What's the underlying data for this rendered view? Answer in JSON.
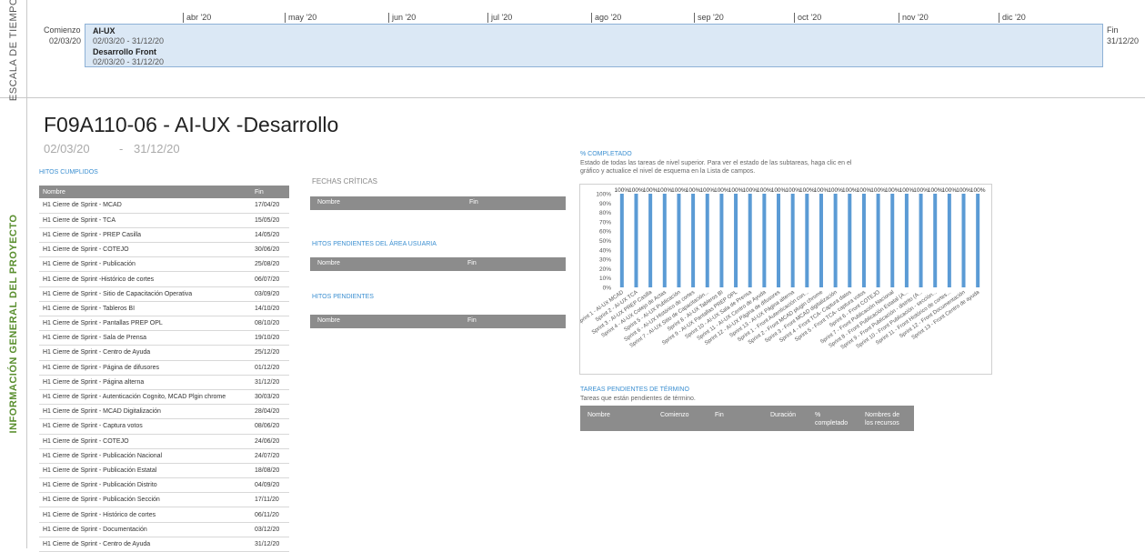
{
  "timeline": {
    "side_label": "ESCALA DE TIEMPO",
    "start_label": "Comienzo",
    "start_date": "02/03/20",
    "end_label": "Fin",
    "end_date": "31/12/20",
    "months": [
      "abr '20",
      "may '20",
      "jun '20",
      "jul '20",
      "ago '20",
      "sep '20",
      "oct '20",
      "nov '20",
      "dic '20"
    ],
    "tasks": [
      {
        "name": "AI-UX",
        "dates": "02/03/20 - 31/12/20"
      },
      {
        "name": "Desarrollo Front",
        "dates": "02/03/20 - 31/12/20"
      }
    ]
  },
  "info": {
    "side_label": "INFORMACIÓN GENERAL DEL PROYECTO",
    "title": "F09A110-06 - AI-UX -Desarrollo",
    "start": "02/03/20",
    "separator": "-",
    "end": "31/12/20"
  },
  "hitos": {
    "title": "HITOS CUMPLIDOS",
    "col_name": "Nombre",
    "col_fin": "Fin",
    "rows": [
      {
        "name": "H1 Cierre de Sprint - MCAD",
        "fin": "17/04/20"
      },
      {
        "name": "H1 Cierre de Sprint - TCA",
        "fin": "15/05/20"
      },
      {
        "name": "H1 Cierre de Sprint - PREP Casilla",
        "fin": "14/05/20"
      },
      {
        "name": "H1 Cierre de Sprint - COTEJO",
        "fin": "30/06/20"
      },
      {
        "name": "H1 Cierre de Sprint - Publicación",
        "fin": "25/08/20"
      },
      {
        "name": "H1 Cierre de Sprint -Histórico de cortes",
        "fin": "06/07/20"
      },
      {
        "name": "H1 Cierre de Sprint - Sitio de Capacitación Operativa",
        "fin": "03/09/20"
      },
      {
        "name": "H1 Cierre de Sprint - Tableros BI",
        "fin": "14/10/20"
      },
      {
        "name": "H1 Cierre de Sprint - Pantallas PREP OPL",
        "fin": "08/10/20"
      },
      {
        "name": "H1 Cierre de Sprint - Sala de Prensa",
        "fin": "19/10/20"
      },
      {
        "name": "H1 Cierre de Sprint - Centro de Ayuda",
        "fin": "25/12/20"
      },
      {
        "name": "H1 Cierre de Sprint - Página de difusores",
        "fin": "01/12/20"
      },
      {
        "name": "H1 Cierre de Sprint - Página alterna",
        "fin": "31/12/20"
      },
      {
        "name": "H1 Cierre de Sprint - Autenticación Cognito, MCAD Plgin chrome",
        "fin": "30/03/20"
      },
      {
        "name": "H1 Cierre de Sprint - MCAD Digitalización",
        "fin": "28/04/20"
      },
      {
        "name": "H1 Cierre de Sprint - Captura votos",
        "fin": "08/06/20"
      },
      {
        "name": "H1 Cierre de Sprint - COTEJO",
        "fin": "24/06/20"
      },
      {
        "name": "H1 Cierre de Sprint - Publicación Nacional",
        "fin": "24/07/20"
      },
      {
        "name": "H1 Cierre de Sprint - Publicación Estatal",
        "fin": "18/08/20"
      },
      {
        "name": "H1 Cierre de Sprint - Publicación Distrito",
        "fin": "04/09/20"
      },
      {
        "name": "H1 Cierre de Sprint - Publicación Sección",
        "fin": "17/11/20"
      },
      {
        "name": "H1 Cierre de Sprint - Histórico de cortes",
        "fin": "06/11/20"
      },
      {
        "name": "H1 Cierre de Sprint - Documentación",
        "fin": "03/12/20"
      },
      {
        "name": "H1 Cierre de Sprint - Centro de Ayuda",
        "fin": "31/12/20"
      }
    ]
  },
  "fechas_criticas": {
    "title": "FECHAS CRÍTICAS",
    "col_name": "Nombre",
    "col_fin": "Fin"
  },
  "hitos_usuaria": {
    "title": "HITOS PENDIENTES DEL ÁREA USUARIA",
    "col_name": "Nombre",
    "col_fin": "Fin"
  },
  "hitos_pendientes": {
    "title": "HITOS PENDIENTES",
    "col_name": "Nombre",
    "col_fin": "Fin"
  },
  "completado": {
    "title": "% COMPLETADO",
    "subtitle_line1": "Estado de todas las tareas de nivel superior. Para ver el estado de las subtareas, haga clic en el",
    "subtitle_line2": "gráfico y actualice el nivel de esquema en la Lista de campos."
  },
  "chart_data": {
    "type": "bar",
    "categories": [
      "Sprint 1 - AI-UX MCAD",
      "Sprint 2 - AI-UX TCA",
      "Sprint 3 - AI-UX PREP Casilla",
      "Sprint 4 - AI-UX Cotejo de Actas",
      "Sprint 5 - AI-UX Publicación",
      "Sprint 6 - AI-UX Histórico de cortes",
      "Sprint 7 - AI-UX Sitio de Capacitación...",
      "Sprint 8 - AI-UX Tableros BI",
      "Sprint 9 - AI-UX Pantallas PREP OPL",
      "Sprint 10 - AI-UX Sala de Prensa",
      "Sprint 11 - AI-UX Centro de Ayuda",
      "Sprint 12 - AI-UX Página de difusores",
      "Sprint 13 - AI-UX Página alterna",
      "Sprint 1 - Front Autenticación con...",
      "Sprint 2 - Front MCAD plugin chrome",
      "Sprint 3 - Front MCAD digitalización",
      "Sprint 4 - Front TCA- Captura datos",
      "Sprint 5 - Front TCA- captura votos",
      "Sprint 6 - Front COTEJO",
      "Sprint 7 - Front Publicación Nacional",
      "Sprint 8 - Front Publicación Estatal (A...",
      "Sprint 9 - Front Publicación - distrito (A...",
      "Sprint 10 - Front Publicación - sección...",
      "Sprint 11 - Front Histórico de cortes...",
      "Sprint 12 - Front Documentación",
      "Sprint 13 - Front Centro de ayuda"
    ],
    "values": [
      100,
      100,
      100,
      100,
      100,
      100,
      100,
      100,
      100,
      100,
      100,
      100,
      100,
      100,
      100,
      100,
      100,
      100,
      100,
      100,
      100,
      100,
      100,
      100,
      100,
      100
    ],
    "data_label_suffix": "%",
    "yticks": [
      "0%",
      "10%",
      "20%",
      "30%",
      "40%",
      "50%",
      "60%",
      "70%",
      "80%",
      "90%",
      "100%"
    ],
    "ylim": [
      0,
      100
    ],
    "grid": false,
    "bar_color": "#5b9bd5"
  },
  "tareas": {
    "title": "TAREAS PENDIENTES DE TÉRMINO",
    "subtitle": "Tareas que están pendientes de término.",
    "col_nombre": "Nombre",
    "col_comienzo": "Comienzo",
    "col_fin": "Fin",
    "col_duracion": "Duración",
    "col_pct_1": "%",
    "col_pct_2": "completado",
    "col_recursos_1": "Nombres de",
    "col_recursos_2": "los recursos"
  }
}
